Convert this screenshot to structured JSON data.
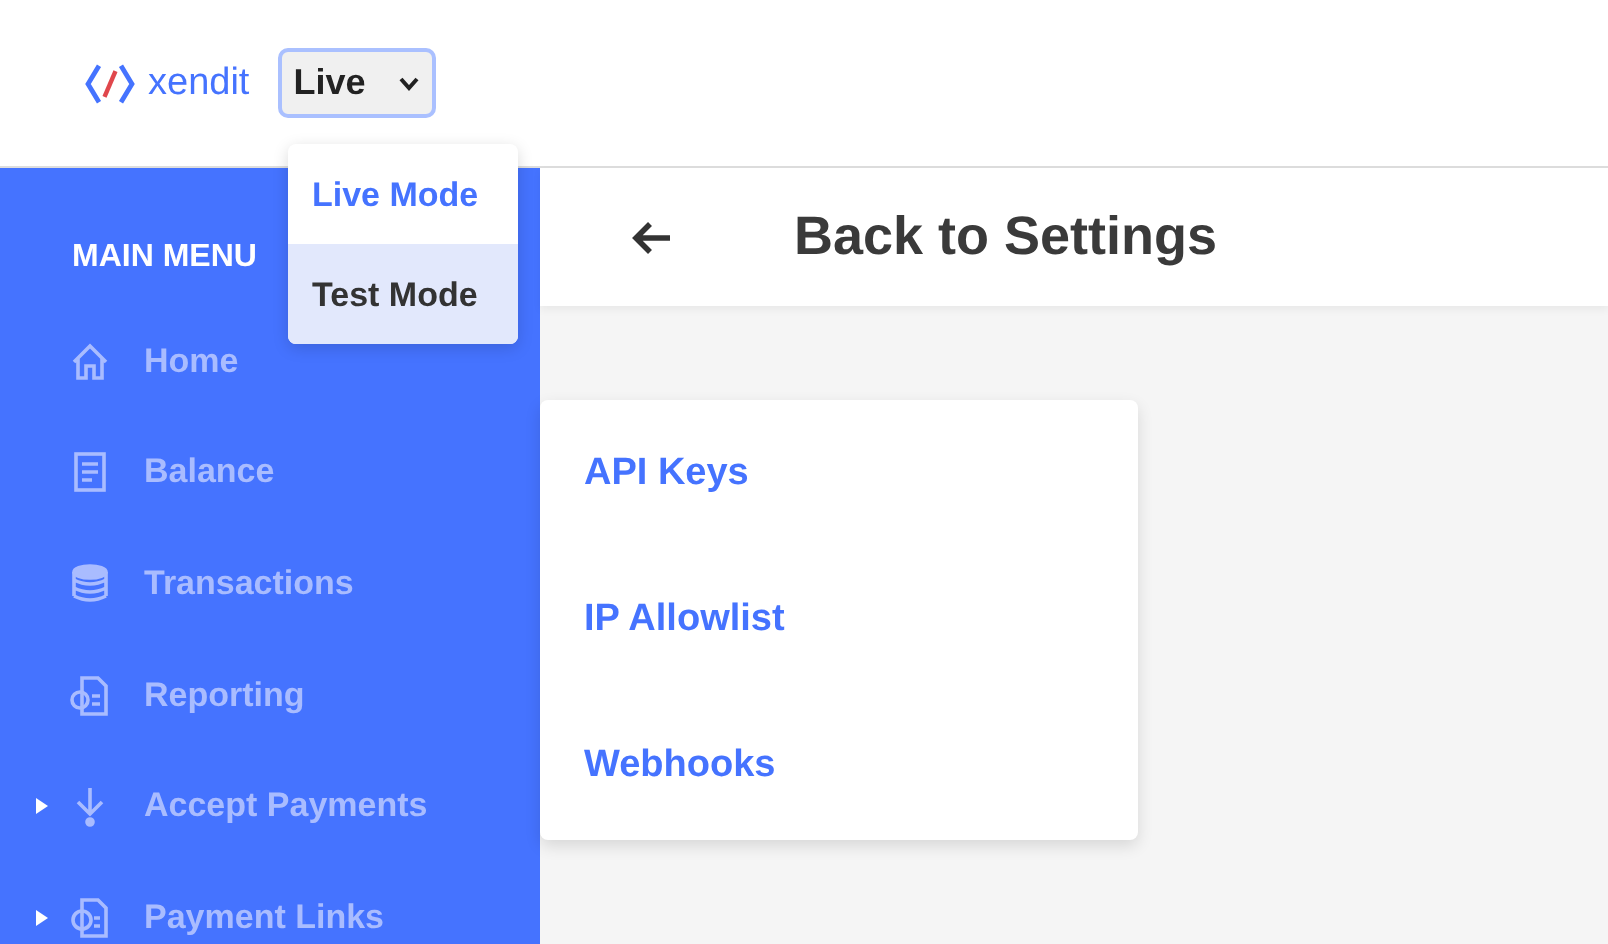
{
  "header": {
    "logo": "xendit",
    "mode_select": {
      "value": "Live",
      "open": true,
      "options": [
        {
          "label": "Live Mode",
          "selected": true,
          "highlighted": false
        },
        {
          "label": "Test Mode",
          "selected": false,
          "highlighted": true
        }
      ]
    }
  },
  "sidebar": {
    "heading": "MAIN MENU",
    "items": [
      {
        "label": "Home",
        "kind": "home",
        "expandable": false
      },
      {
        "label": "Balance",
        "kind": "ledger",
        "expandable": false
      },
      {
        "label": "Transactions",
        "kind": "coins",
        "expandable": false
      },
      {
        "label": "Reporting",
        "kind": "report",
        "expandable": false
      },
      {
        "label": "Accept Payments",
        "kind": "download",
        "expandable": true
      },
      {
        "label": "Payment Links",
        "kind": "invoice",
        "expandable": true
      }
    ]
  },
  "page": {
    "back_title": "Back to Settings",
    "links": [
      "API Keys",
      "IP Allowlist",
      "Webhooks"
    ]
  }
}
